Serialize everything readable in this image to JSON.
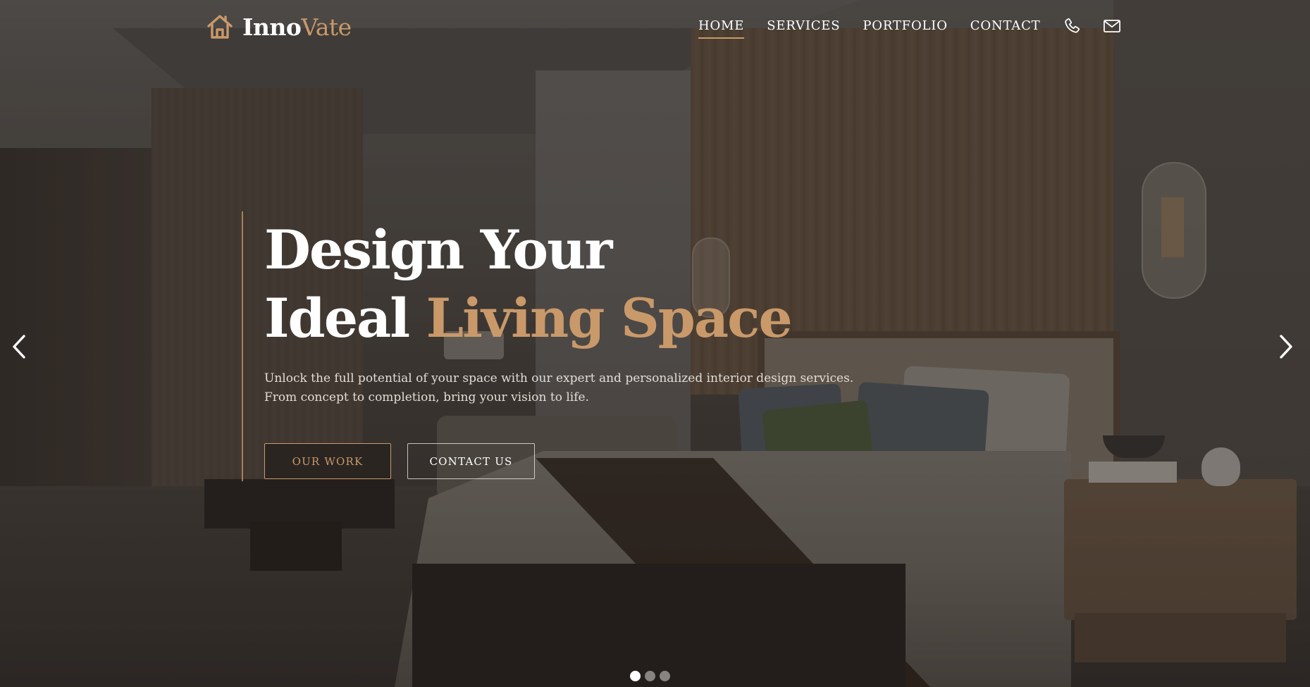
{
  "brand": {
    "name_part1": "Inno",
    "name_part2": "Vate",
    "icon": "house-icon",
    "accent_color": "#c9996a"
  },
  "nav": {
    "items": [
      {
        "label": "HOME",
        "active": true
      },
      {
        "label": "SERVICES",
        "active": false
      },
      {
        "label": "PORTFOLIO",
        "active": false
      },
      {
        "label": "CONTACT",
        "active": false
      }
    ],
    "icons": [
      "phone-icon",
      "mail-icon"
    ]
  },
  "hero": {
    "headline_line1": "Design Your",
    "headline_line2_a": "Ideal",
    "headline_line2_b": "Living Space",
    "subtext_line1": "Unlock the full potential of your space with our expert and personalized interior design services.",
    "subtext_line2": "From concept to completion, bring your vision to life.",
    "buttons": {
      "primary": "OUR WORK",
      "secondary": "CONTACT US"
    },
    "background": "bedroom-interior-photo"
  },
  "slider": {
    "prev_icon": "chevron-left-icon",
    "next_icon": "chevron-right-icon",
    "dot_count": 3,
    "active_dot": 1
  },
  "colors": {
    "accent": "#c9996a",
    "text_light": "#ffffff",
    "button_dark": "#2a2521"
  }
}
